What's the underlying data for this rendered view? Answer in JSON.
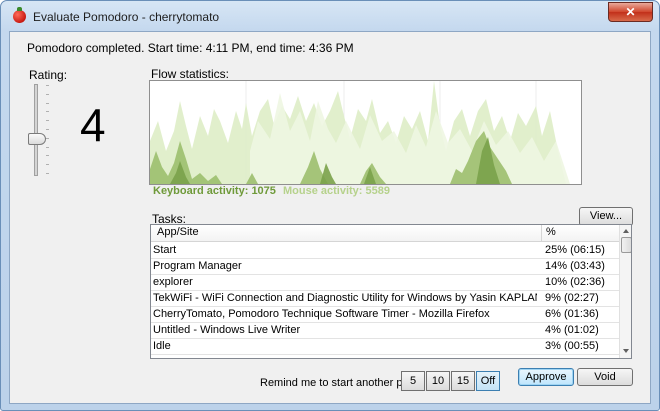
{
  "window": {
    "title": "Evaluate Pomodoro - cherrytomato",
    "close_glyph": "✕"
  },
  "status_text": "Pomodoro completed. Start time: 4:11 PM, end time: 4:36 PM",
  "rating": {
    "label": "Rating:",
    "value": "4",
    "slider_level": 4,
    "slider_steps": 10
  },
  "flow": {
    "label": "Flow statistics:",
    "keyboard_label": "Keyboard activity:",
    "keyboard_value": "1075",
    "mouse_label": "Mouse activity:",
    "mouse_value": "5589"
  },
  "tasks": {
    "label": "Tasks:",
    "view_button": "View...",
    "columns": [
      "App/Site",
      "%"
    ],
    "rows": [
      {
        "app": "Start",
        "pct": "25% (06:15)"
      },
      {
        "app": "Program Manager",
        "pct": "14% (03:43)"
      },
      {
        "app": "explorer",
        "pct": "10% (02:36)"
      },
      {
        "app": "TekWiFi - WiFi Connection and Diagnostic Utility for Windows by Yasin KAPLAN - Google Chro...",
        "pct": "9% (02:27)"
      },
      {
        "app": "CherryTomato, Pomodoro Technique Software Timer - Mozilla Firefox",
        "pct": "6% (01:36)"
      },
      {
        "app": "Untitled - Windows Live Writer",
        "pct": "4% (01:02)"
      },
      {
        "app": "Idle",
        "pct": "3% (00:55)"
      }
    ]
  },
  "remind": {
    "label": "Remind me to start another pomod",
    "options": [
      "5",
      "10",
      "15",
      "Off"
    ],
    "selected": "Off"
  },
  "actions": {
    "approve": "Approve",
    "void": "Void"
  },
  "colors": {
    "keyboard": "#6f9a3a",
    "mouse": "#b6d28c"
  },
  "icons": [
    "tomato-icon",
    "close-icon",
    "scroll-up-arrow-icon",
    "scroll-down-arrow-icon"
  ]
}
